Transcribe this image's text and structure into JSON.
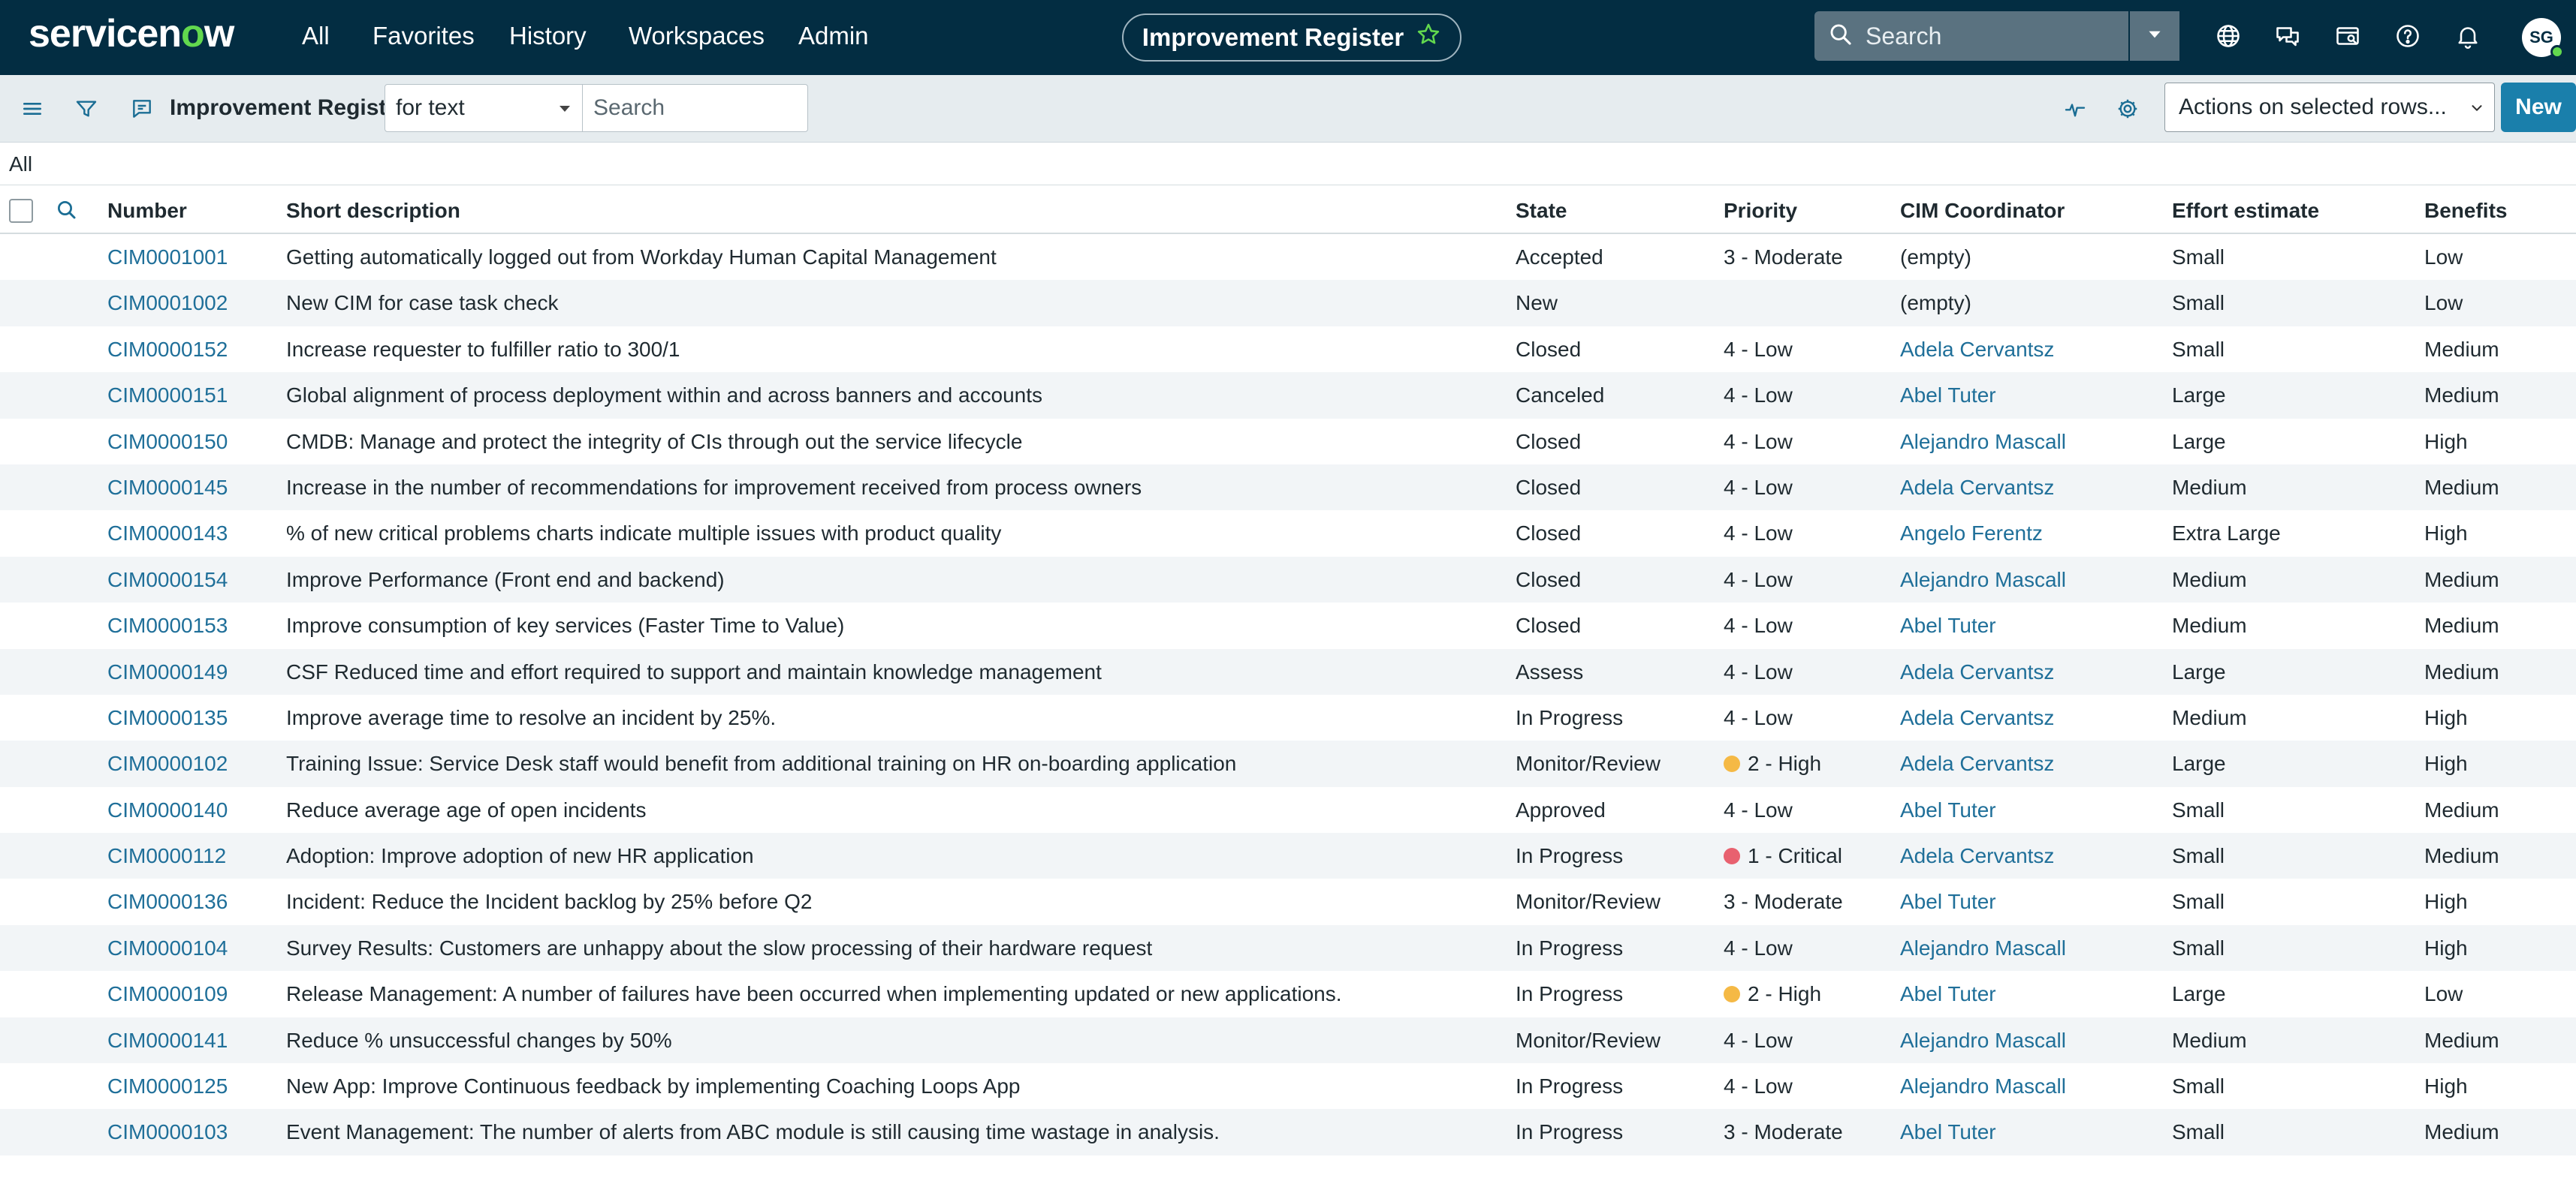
{
  "app": {
    "logo_text_1": "servicen",
    "logo_text_2": "o",
    "logo_text_3": "w",
    "nav": [
      "All",
      "Favorites",
      "History",
      "Workspaces",
      "Admin"
    ],
    "context_pill": "Improvement Register",
    "global_search_placeholder": "Search",
    "avatar_initials": "SG"
  },
  "toolbar": {
    "title": "Improvement Register",
    "filter_field": "for text",
    "search_placeholder": "Search",
    "actions_label": "Actions on selected rows...",
    "new_label": "New"
  },
  "breadcrumb": "All",
  "columns": {
    "number": "Number",
    "short_description": "Short description",
    "state": "State",
    "priority": "Priority",
    "coordinator": "CIM Coordinator",
    "effort": "Effort estimate",
    "benefits": "Benefits"
  },
  "colors": {
    "topbar": "#032d42",
    "link": "#1f6f99",
    "high_dot": "#f5b945",
    "critical_dot": "#e8616f",
    "new_button": "#1a7fab"
  },
  "rows": [
    {
      "number": "CIM0001001",
      "desc": "Getting automatically logged out from Workday Human Capital Management",
      "state": "Accepted",
      "priority": "3 - Moderate",
      "dot": "",
      "coordinator": "(empty)",
      "coord_link": false,
      "effort": "Small",
      "benefits": "Low"
    },
    {
      "number": "CIM0001002",
      "desc": "New CIM for case task check",
      "state": "New",
      "priority": "",
      "dot": "",
      "coordinator": "(empty)",
      "coord_link": false,
      "effort": "Small",
      "benefits": "Low"
    },
    {
      "number": "CIM0000152",
      "desc": "Increase requester to fulfiller ratio to 300/1",
      "state": "Closed",
      "priority": "4 - Low",
      "dot": "",
      "coordinator": "Adela Cervantsz",
      "coord_link": true,
      "effort": "Small",
      "benefits": "Medium"
    },
    {
      "number": "CIM0000151",
      "desc": "Global alignment of process deployment within and across banners and accounts",
      "state": "Canceled",
      "priority": "4 - Low",
      "dot": "",
      "coordinator": "Abel Tuter",
      "coord_link": true,
      "effort": "Large",
      "benefits": "Medium"
    },
    {
      "number": "CIM0000150",
      "desc": "CMDB: Manage and protect the integrity of CIs through out the service lifecycle",
      "state": "Closed",
      "priority": "4 - Low",
      "dot": "",
      "coordinator": "Alejandro Mascall",
      "coord_link": true,
      "effort": "Large",
      "benefits": "High"
    },
    {
      "number": "CIM0000145",
      "desc": "Increase in the number of recommendations for improvement received from process owners",
      "state": "Closed",
      "priority": "4 - Low",
      "dot": "",
      "coordinator": "Adela Cervantsz",
      "coord_link": true,
      "effort": "Medium",
      "benefits": "Medium"
    },
    {
      "number": "CIM0000143",
      "desc": "% of new critical problems charts indicate multiple issues with product quality",
      "state": "Closed",
      "priority": "4 - Low",
      "dot": "",
      "coordinator": "Angelo Ferentz",
      "coord_link": true,
      "effort": "Extra Large",
      "benefits": "High"
    },
    {
      "number": "CIM0000154",
      "desc": "Improve Performance (Front end and backend)",
      "state": "Closed",
      "priority": "4 - Low",
      "dot": "",
      "coordinator": "Alejandro Mascall",
      "coord_link": true,
      "effort": "Medium",
      "benefits": "Medium"
    },
    {
      "number": "CIM0000153",
      "desc": "Improve consumption of key services (Faster Time to Value)",
      "state": "Closed",
      "priority": "4 - Low",
      "dot": "",
      "coordinator": "Abel Tuter",
      "coord_link": true,
      "effort": "Medium",
      "benefits": "Medium"
    },
    {
      "number": "CIM0000149",
      "desc": "CSF Reduced time and effort required to support and maintain knowledge management",
      "state": "Assess",
      "priority": "4 - Low",
      "dot": "",
      "coordinator": "Adela Cervantsz",
      "coord_link": true,
      "effort": "Large",
      "benefits": "Medium"
    },
    {
      "number": "CIM0000135",
      "desc": "Improve average time to resolve an incident by 25%.",
      "state": "In Progress",
      "priority": "4 - Low",
      "dot": "",
      "coordinator": "Adela Cervantsz",
      "coord_link": true,
      "effort": "Medium",
      "benefits": "High"
    },
    {
      "number": "CIM0000102",
      "desc": "Training Issue: Service Desk staff would benefit from additional training on HR on-boarding application",
      "state": "Monitor/Review",
      "priority": "2 - High",
      "dot": "high",
      "coordinator": "Adela Cervantsz",
      "coord_link": true,
      "effort": "Large",
      "benefits": "High"
    },
    {
      "number": "CIM0000140",
      "desc": "Reduce average age of open incidents",
      "state": "Approved",
      "priority": "4 - Low",
      "dot": "",
      "coordinator": "Abel Tuter",
      "coord_link": true,
      "effort": "Small",
      "benefits": "Medium"
    },
    {
      "number": "CIM0000112",
      "desc": "Adoption: Improve adoption of new HR application",
      "state": "In Progress",
      "priority": "1 - Critical",
      "dot": "critical",
      "coordinator": "Adela Cervantsz",
      "coord_link": true,
      "effort": "Small",
      "benefits": "Medium"
    },
    {
      "number": "CIM0000136",
      "desc": "Incident: Reduce the Incident backlog by 25% before Q2",
      "state": "Monitor/Review",
      "priority": "3 - Moderate",
      "dot": "",
      "coordinator": "Abel Tuter",
      "coord_link": true,
      "effort": "Small",
      "benefits": "High"
    },
    {
      "number": "CIM0000104",
      "desc": "Survey Results: Customers are unhappy about the slow processing of their hardware request",
      "state": "In Progress",
      "priority": "4 - Low",
      "dot": "",
      "coordinator": "Alejandro Mascall",
      "coord_link": true,
      "effort": "Small",
      "benefits": "High"
    },
    {
      "number": "CIM0000109",
      "desc": "Release Management: A number of failures have been occurred when implementing updated or new applications.",
      "state": "In Progress",
      "priority": "2 - High",
      "dot": "high",
      "coordinator": "Abel Tuter",
      "coord_link": true,
      "effort": "Large",
      "benefits": "Low"
    },
    {
      "number": "CIM0000141",
      "desc": "Reduce % unsuccessful changes by 50%",
      "state": "Monitor/Review",
      "priority": "4 - Low",
      "dot": "",
      "coordinator": "Alejandro Mascall",
      "coord_link": true,
      "effort": "Medium",
      "benefits": "Medium"
    },
    {
      "number": "CIM0000125",
      "desc": "New App: Improve Continuous feedback by implementing Coaching Loops App",
      "state": "In Progress",
      "priority": "4 - Low",
      "dot": "",
      "coordinator": "Alejandro Mascall",
      "coord_link": true,
      "effort": "Small",
      "benefits": "High"
    },
    {
      "number": "CIM0000103",
      "desc": "Event Management: The number of alerts from ABC module is still causing time wastage in analysis.",
      "state": "In Progress",
      "priority": "3 - Moderate",
      "dot": "",
      "coordinator": "Abel Tuter",
      "coord_link": true,
      "effort": "Small",
      "benefits": "Medium"
    }
  ]
}
